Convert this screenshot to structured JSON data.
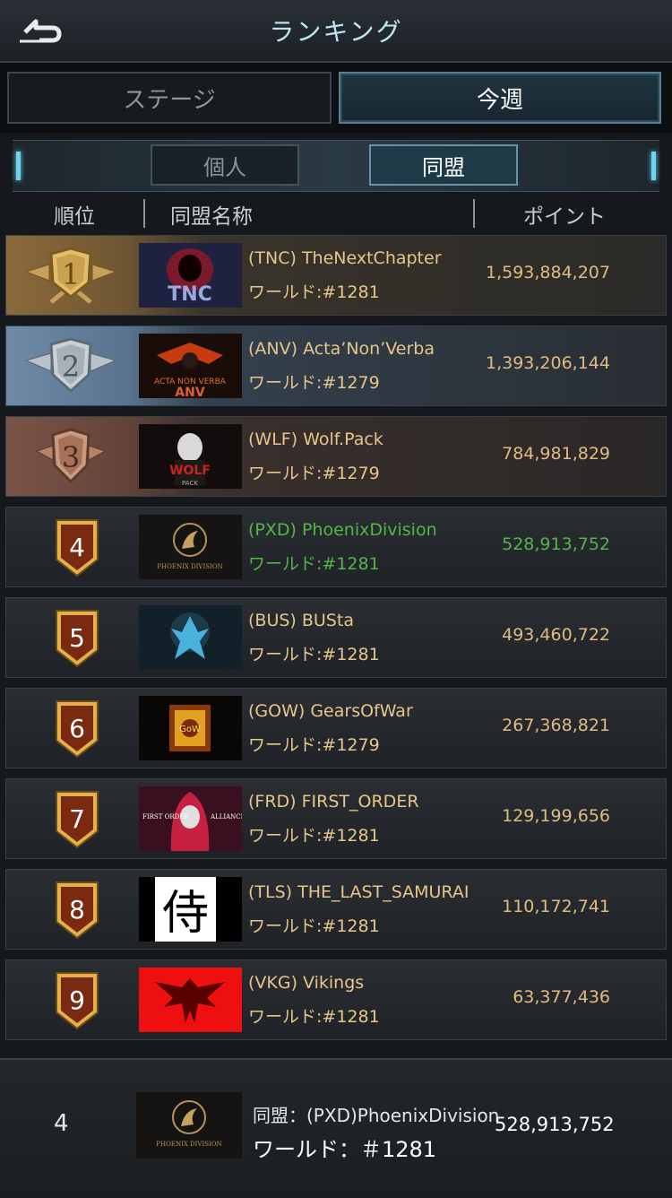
{
  "header": {
    "title": "ランキング",
    "back_icon": "back-arrow-icon"
  },
  "tabs": {
    "stage": "ステージ",
    "week": "今週"
  },
  "subtabs": {
    "individual": "個人",
    "alliance": "同盟"
  },
  "columns": {
    "rank": "順位",
    "name": "同盟名称",
    "points": "ポイント"
  },
  "rows": [
    {
      "rank": "1",
      "name": "(TNC) TheNextChapter",
      "world": "ワールド:#1281",
      "points": "1,593,884,207"
    },
    {
      "rank": "2",
      "name": "(ANV) Acta’Non’Verba",
      "world": "ワールド:#1279",
      "points": "1,393,206,144"
    },
    {
      "rank": "3",
      "name": "(WLF) Wolf.Pack",
      "world": "ワールド:#1279",
      "points": "784,981,829"
    },
    {
      "rank": "4",
      "name": "(PXD) PhoenixDivision",
      "world": "ワールド:#1281",
      "points": "528,913,752"
    },
    {
      "rank": "5",
      "name": "(BUS) BUSta",
      "world": "ワールド:#1281",
      "points": "493,460,722"
    },
    {
      "rank": "6",
      "name": "(GOW) GearsOfWar",
      "world": "ワールド:#1279",
      "points": "267,368,821"
    },
    {
      "rank": "7",
      "name": "(FRD) FIRST_ORDER",
      "world": "ワールド:#1281",
      "points": "129,199,656"
    },
    {
      "rank": "8",
      "name": "(TLS) THE_LAST_SAMURAI",
      "world": "ワールド:#1281",
      "points": "110,172,741"
    },
    {
      "rank": "9",
      "name": "(VKG) Vikings",
      "world": "ワールド:#1281",
      "points": "63,377,436"
    }
  ],
  "logo_texts": {
    "tnc": "TNC",
    "anv_line": "ACTA NON VERBA",
    "anv": "ANV",
    "wolf": "WOLF",
    "wolf_sub": "PACK",
    "phoenix": "PHOENIX DIVISION",
    "gow": "GoW",
    "frd_left": "FIRST ORDER",
    "frd_right": "ALLIANCE",
    "samurai": "侍"
  },
  "footer": {
    "rank": "4",
    "alliance": "同盟：(PXD)PhoenixDivision",
    "world": "ワールド：＃1281",
    "points": "528,913,752"
  },
  "colors": {
    "gold_text": "#e8c58a",
    "highlight_green": "#54b548",
    "accent_cyan": "#6fd4f0"
  }
}
